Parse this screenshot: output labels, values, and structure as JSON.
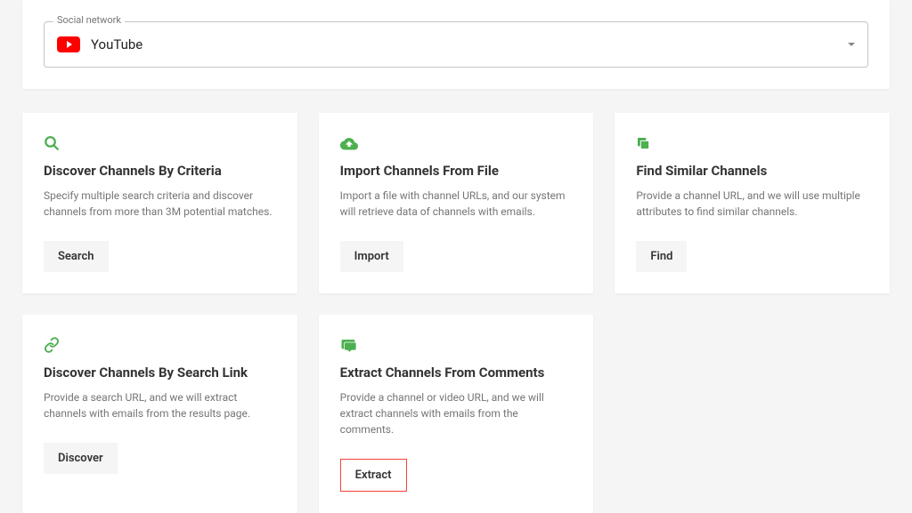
{
  "select": {
    "legend": "Social network",
    "value": "YouTube"
  },
  "cards": [
    {
      "title": "Discover Channels By Criteria",
      "desc": "Specify multiple search criteria and discover channels from more than 3M potential matches.",
      "button": "Search"
    },
    {
      "title": "Import Channels From File",
      "desc": "Import a file with channel URLs, and our system will retrieve data of channels with emails.",
      "button": "Import"
    },
    {
      "title": "Find Similar Channels",
      "desc": "Provide a channel URL, and we will use multiple attributes to find similar channels.",
      "button": "Find"
    },
    {
      "title": "Discover Channels By Search Link",
      "desc": "Provide a search URL, and we will extract channels with emails from the results page.",
      "button": "Discover"
    },
    {
      "title": "Extract Channels From Comments",
      "desc": "Provide a channel or video URL, and we will extract channels with emails from the comments.",
      "button": "Extract"
    }
  ]
}
